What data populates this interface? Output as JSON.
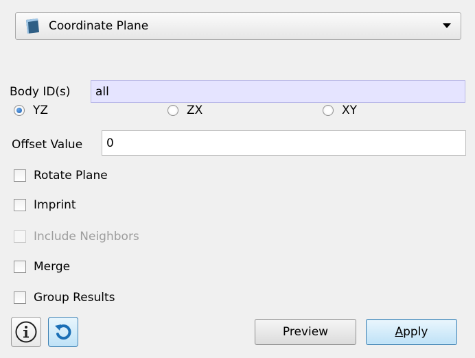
{
  "dropdown": {
    "selected": "Coordinate Plane",
    "icon": "plane-icon",
    "arrow": "chevron-down-icon"
  },
  "body_ids": {
    "label": "Body ID(s)",
    "value": "all"
  },
  "planes": [
    {
      "label": "YZ",
      "checked": true
    },
    {
      "label": "ZX",
      "checked": false
    },
    {
      "label": "XY",
      "checked": false
    }
  ],
  "offset": {
    "label": "Offset Value",
    "value": "0"
  },
  "options": [
    {
      "label": "Rotate Plane",
      "checked": false,
      "enabled": true
    },
    {
      "label": "Imprint",
      "checked": false,
      "enabled": true
    },
    {
      "label": "Include Neighbors",
      "checked": false,
      "enabled": false
    },
    {
      "label": "Merge",
      "checked": false,
      "enabled": true
    },
    {
      "label": "Group Results",
      "checked": false,
      "enabled": true
    }
  ],
  "buttons": {
    "info_icon": "info-icon",
    "reset_icon": "undo-icon",
    "preview": "Preview",
    "apply": "Apply"
  }
}
